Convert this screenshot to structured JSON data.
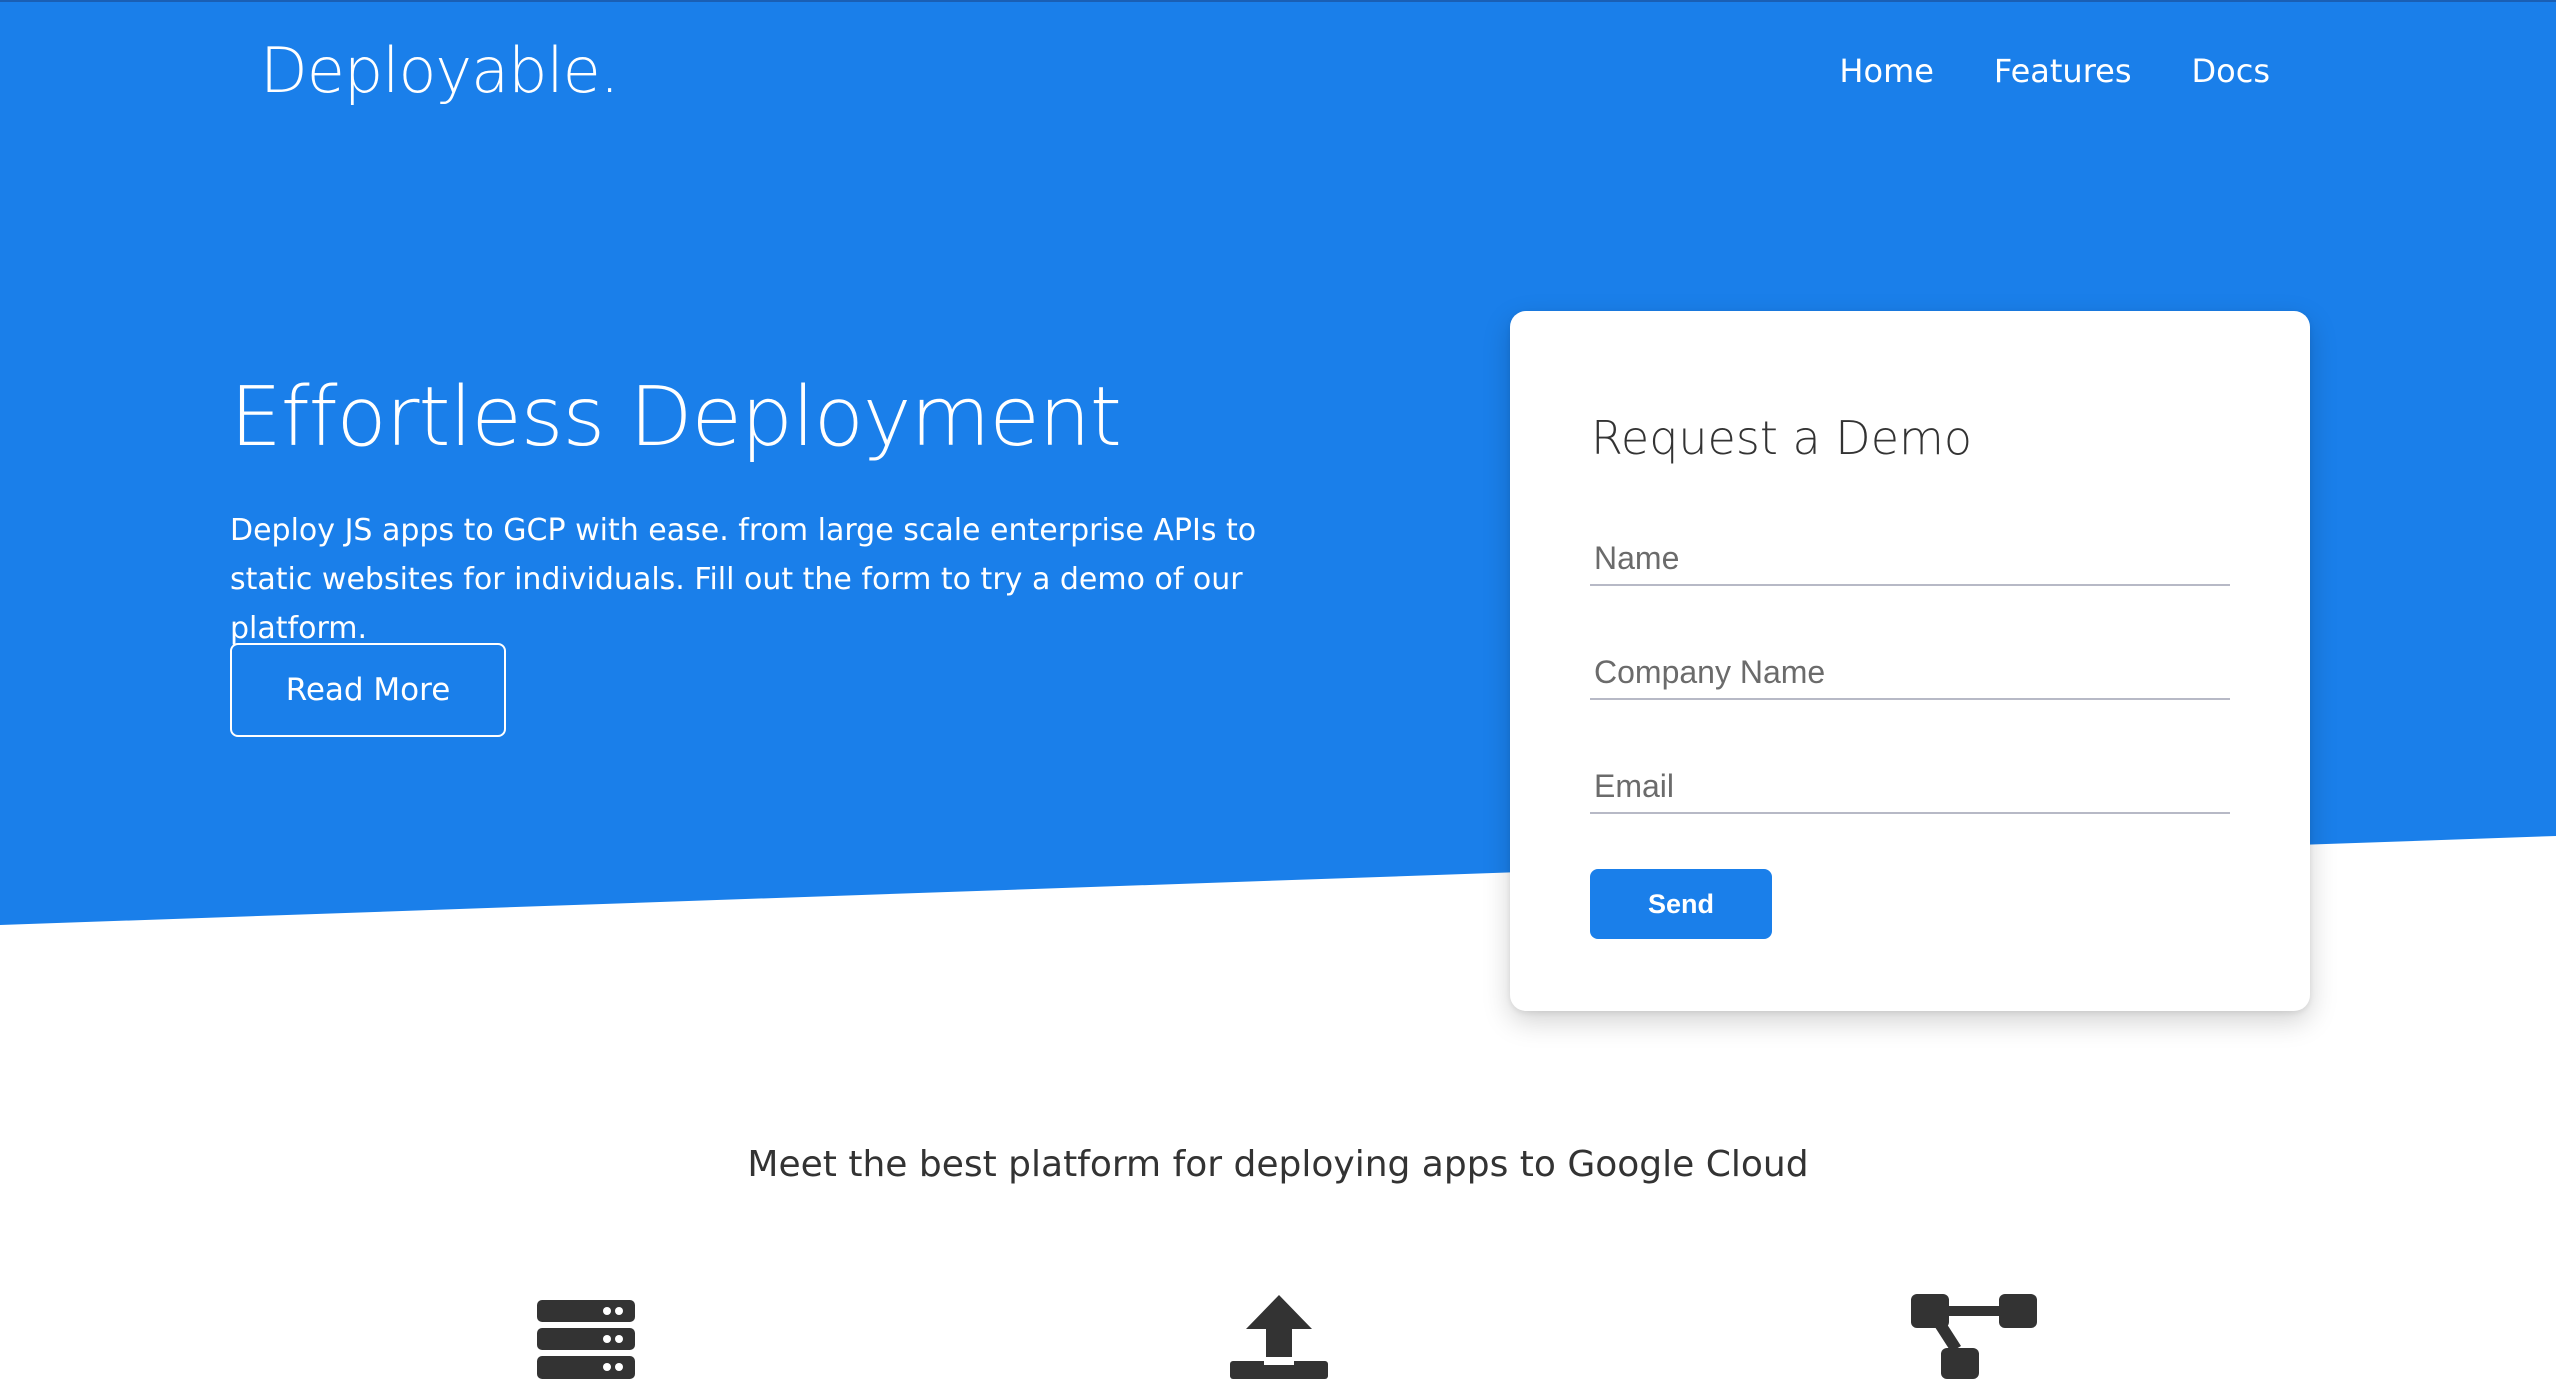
{
  "colors": {
    "brand_blue": "#1a7fea",
    "text_dark": "#333333",
    "icon_dark": "#333333"
  },
  "header": {
    "logo": "Deployable.",
    "nav": [
      {
        "label": "Home"
      },
      {
        "label": "Features"
      },
      {
        "label": "Docs"
      }
    ]
  },
  "hero": {
    "title": "Effortless Deployment",
    "description": "Deploy JS apps to GCP with ease. from large scale enterprise APIs to static websites for individuals. Fill out the form to try a demo of our platform.",
    "read_more_label": "Read More"
  },
  "demo_form": {
    "title": "Request a Demo",
    "fields": [
      {
        "placeholder": "Name",
        "value": ""
      },
      {
        "placeholder": "Company Name",
        "value": ""
      },
      {
        "placeholder": "Email",
        "value": ""
      }
    ],
    "send_label": "Send"
  },
  "features": {
    "tagline": "Meet the best platform for deploying apps to Google Cloud",
    "icons": [
      "server-icon",
      "upload-icon",
      "network-tree-icon"
    ]
  }
}
